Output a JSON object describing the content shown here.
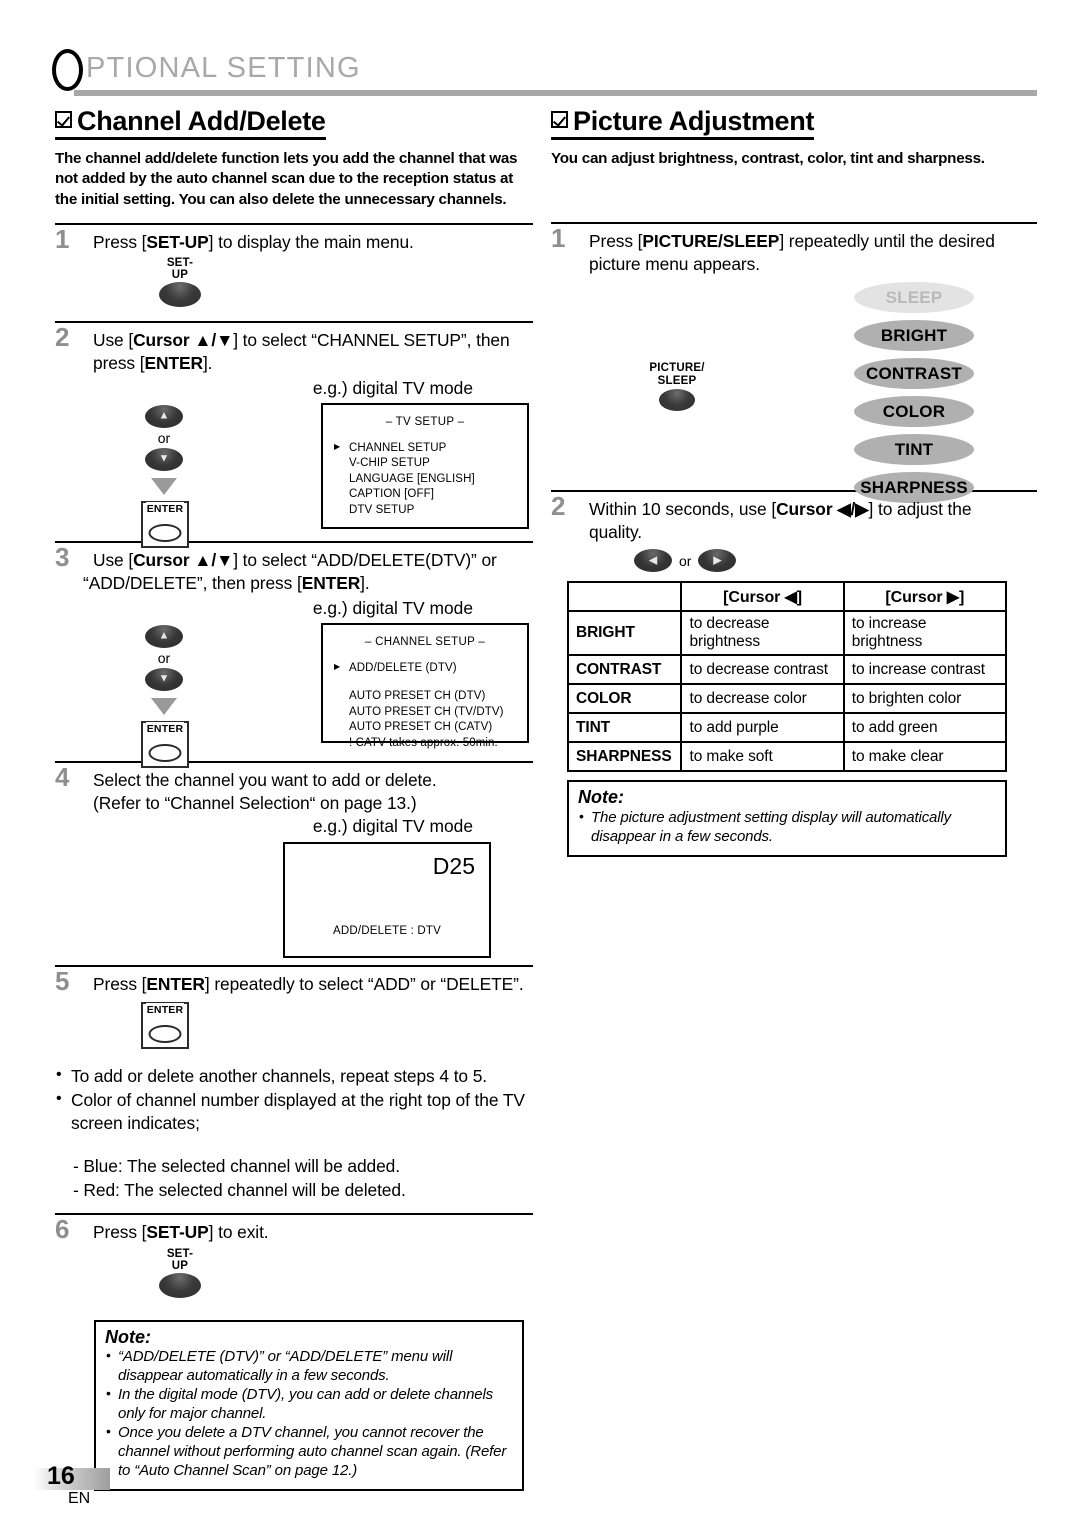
{
  "header": {
    "title_first_letter": "O",
    "title_rest": "PTIONAL  SETTING"
  },
  "left_column": {
    "section_title": "Channel Add/Delete",
    "section_intro": "The channel add/delete function lets you add the channel that was not added by the auto channel scan due to the reception status at the initial setting. You can also delete the unnecessary channels.",
    "steps": [
      {
        "num": "1",
        "text_html": "Press [<b>SET-UP</b>] to display the main menu.",
        "button_label": "SET-UP"
      },
      {
        "num": "2",
        "line1": "Use [Cursor ▲ / ▼] to select “CHANNEL SETUP”, then",
        "line2": "press [ENTER].",
        "or_label": "or",
        "enter_label": "ENTER",
        "eg_label": "e.g.) digital TV mode",
        "osd": {
          "title": "–  TV SETUP  –",
          "items": [
            "CHANNEL SETUP",
            "V-CHIP  SETUP",
            "LANGUAGE        [ENGLISH]",
            "CAPTION        [OFF]",
            "DTV SETUP"
          ]
        }
      },
      {
        "num": "3",
        "line1": "Use [Cursor ▲ / ▼] to select “ADD/DELETE(DTV)” or",
        "line2": "“ADD/DELETE”, then press [ENTER].",
        "or_label": "or",
        "enter_label": "ENTER",
        "eg_label": "e.g.) digital TV mode",
        "osd": {
          "title": "–  CHANNEL SETUP  –",
          "item_selected": "ADD/DELETE (DTV)",
          "items": [
            "AUTO PRESET CH (DTV)",
            "AUTO PRESET CH (TV/DTV)",
            "AUTO PRESET CH (CATV)",
            "! CATV takes approx. 50min."
          ]
        }
      },
      {
        "num": "4",
        "line1": "Select the channel you want to add or delete.",
        "line2": "(Refer to “Channel Selection“ on page 13.)",
        "eg_label": "e.g.) digital TV mode",
        "osd": {
          "channel": "D25",
          "mode_label": "ADD/DELETE : DTV"
        }
      },
      {
        "num": "5",
        "text_html": "Press [<b>ENTER</b>] repeatedly to select “ADD” or “DELETE”.",
        "enter_label": "ENTER"
      },
      {
        "num": "6",
        "text_html": "Press [<b>SET-UP</b>] to exit.",
        "button_label": "SET-UP"
      }
    ],
    "bullets": [
      "To add or delete another channels, repeat steps 4 to 5.",
      "Color of channel number displayed at the right top of the TV screen indicates;"
    ],
    "dash_items": [
      "- Blue: The selected channel will be added.",
      "- Red: The selected channel will be deleted."
    ],
    "note": {
      "title": "Note:",
      "items": [
        "“ADD/DELETE (DTV)” or “ADD/DELETE” menu will disappear automatically in a few seconds.",
        "In the digital mode (DTV), you can add or delete channels only for major channel.",
        "Once you delete a DTV channel, you cannot recover the channel without performing auto channel scan again. (Refer to “Auto Channel Scan” on page 12.)"
      ]
    }
  },
  "right_column": {
    "section_title": "Picture Adjustment",
    "section_intro": "You can adjust brightness, contrast, color, tint and sharpness.",
    "steps": [
      {
        "num": "1",
        "line1": "Press [PICTURE/SLEEP] repeatedly until the desired",
        "line2": "picture menu appears.",
        "button_label_line1": "PICTURE/",
        "button_label_line2": "SLEEP",
        "menu_ovals": [
          "SLEEP",
          "BRIGHT",
          "CONTRAST",
          "COLOR",
          "TINT",
          "SHARPNESS"
        ],
        "dim_oval": "SLEEP"
      },
      {
        "num": "2",
        "line1": "Within 10 seconds, use [Cursor ◀/▶] to adjust the",
        "line2": "quality.",
        "or_label": "or"
      }
    ],
    "table": {
      "headers": [
        "",
        "[Cursor ◀]",
        "[Cursor ▶]"
      ],
      "rows": [
        {
          "name": "BRIGHT",
          "left": "to decrease brightness",
          "right": "to increase brightness"
        },
        {
          "name": "CONTRAST",
          "left": "to decrease contrast",
          "right": "to increase contrast"
        },
        {
          "name": "COLOR",
          "left": "to decrease color",
          "right": "to brighten color"
        },
        {
          "name": "TINT",
          "left": "to add purple",
          "right": "to add green"
        },
        {
          "name": "SHARPNESS",
          "left": "to make soft",
          "right": "to make clear"
        }
      ]
    },
    "note": {
      "title": "Note:",
      "items": [
        "The picture adjustment setting display will automatically disappear in a few seconds."
      ]
    }
  },
  "footer": {
    "page_number": "16",
    "language": "EN"
  },
  "colors": {
    "header_gray": "#a8a8a8",
    "step_number_gray": "#8f8f8f",
    "oval_gray": "#b0b0b0",
    "oval_dim_gray": "#e3e3e3"
  }
}
